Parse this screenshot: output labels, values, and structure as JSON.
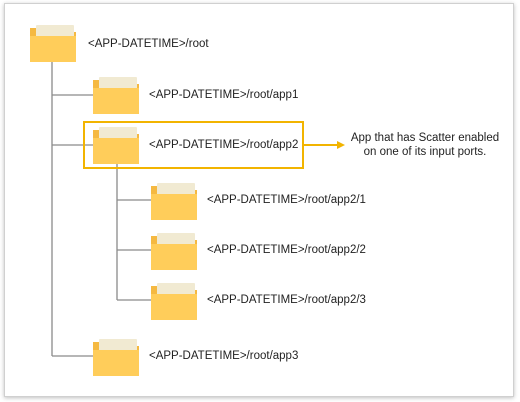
{
  "tree": {
    "root": {
      "label": "<APP-DATETIME>/root",
      "icon": "folder-icon"
    },
    "app1": {
      "label": "<APP-DATETIME>/root/app1",
      "icon": "folder-icon"
    },
    "app2": {
      "label": "<APP-DATETIME>/root/app2",
      "icon": "folder-icon",
      "highlighted": true
    },
    "app2_1": {
      "label": "<APP-DATETIME>/root/app2/1",
      "icon": "folder-icon"
    },
    "app2_2": {
      "label": "<APP-DATETIME>/root/app2/2",
      "icon": "folder-icon"
    },
    "app2_3": {
      "label": "<APP-DATETIME>/root/app2/3",
      "icon": "folder-icon"
    },
    "app3": {
      "label": "<APP-DATETIME>/root/app3",
      "icon": "folder-icon"
    }
  },
  "annotation": {
    "line1": "App that has Scatter enabled",
    "line2": "on one of its input ports."
  },
  "colors": {
    "highlight": "#f2b400",
    "connector": "#8a8a8a",
    "folder_front": "#ffcd5a",
    "folder_back": "#f5b941",
    "folder_paper": "#f1ead2"
  }
}
